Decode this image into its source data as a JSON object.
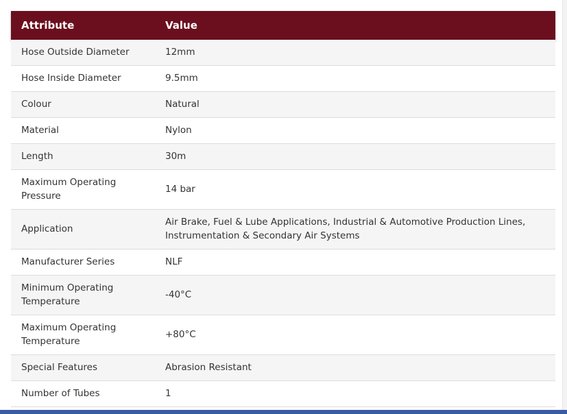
{
  "table": {
    "header": {
      "attribute": "Attribute",
      "value": "Value"
    },
    "rows": [
      {
        "attribute": "Hose Outside Diameter",
        "value": "12mm"
      },
      {
        "attribute": "Hose Inside Diameter",
        "value": "9.5mm"
      },
      {
        "attribute": "Colour",
        "value": "Natural"
      },
      {
        "attribute": "Material",
        "value": "Nylon"
      },
      {
        "attribute": "Length",
        "value": "30m"
      },
      {
        "attribute": "Maximum Operating Pressure",
        "value": "14 bar"
      },
      {
        "attribute": "Application",
        "value": "Air Brake, Fuel & Lube Applications, Industrial & Automotive Production Lines, Instrumentation & Secondary Air Systems"
      },
      {
        "attribute": "Manufacturer Series",
        "value": "NLF"
      },
      {
        "attribute": "Minimum Operating Temperature",
        "value": "-40°C"
      },
      {
        "attribute": "Maximum Operating Temperature",
        "value": "+80°C"
      },
      {
        "attribute": "Special Features",
        "value": "Abrasion Resistant"
      },
      {
        "attribute": "Number of Tubes",
        "value": "1"
      }
    ]
  },
  "colors": {
    "header_background": "#6b0f1e",
    "header_text": "#ffffff",
    "row_alt": "#f5f5f5",
    "bottom_accent": "#3b5aa6"
  }
}
